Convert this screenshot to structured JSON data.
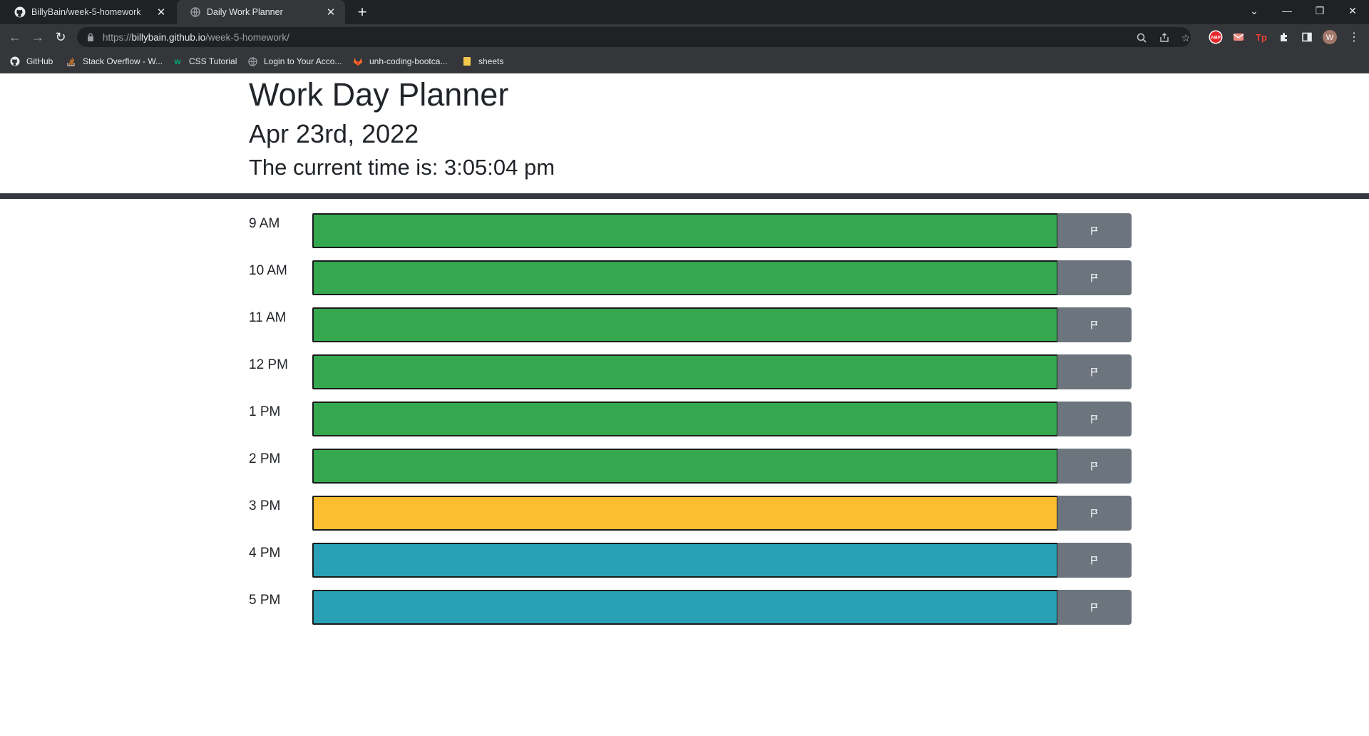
{
  "browser": {
    "tabs": [
      {
        "title": "BillyBain/week-5-homework",
        "icon": "github-icon",
        "active": false
      },
      {
        "title": "Daily Work Planner",
        "icon": "globe-icon",
        "active": true
      }
    ],
    "url": {
      "scheme": "https://",
      "host": "billybain.github.io",
      "path": "/week-5-homework/"
    },
    "bookmarks": [
      {
        "label": "GitHub",
        "icon": "github-icon"
      },
      {
        "label": "Stack Overflow - W...",
        "icon": "stackoverflow-icon"
      },
      {
        "label": "CSS Tutorial",
        "icon": "w3schools-icon"
      },
      {
        "label": "Login to Your Acco...",
        "icon": "globe-icon"
      },
      {
        "label": "unh-coding-bootca...",
        "icon": "gitlab-icon"
      },
      {
        "label": "sheets",
        "icon": "folder-icon"
      }
    ],
    "extensions": {
      "abp_label": "ABP",
      "tp_label": "Tp",
      "profile_initial": "W"
    }
  },
  "page": {
    "title": "Work Day Planner",
    "date": "Apr 23rd, 2022",
    "current_time": "The current time is: 3:05:04 pm"
  },
  "planner": {
    "rows": [
      {
        "hour": "9 AM",
        "status": "past",
        "color": "#34a84f",
        "text": ""
      },
      {
        "hour": "10 AM",
        "status": "past",
        "color": "#34a84f",
        "text": ""
      },
      {
        "hour": "11 AM",
        "status": "past",
        "color": "#34a84f",
        "text": ""
      },
      {
        "hour": "12 PM",
        "status": "past",
        "color": "#34a84f",
        "text": ""
      },
      {
        "hour": "1 PM",
        "status": "past",
        "color": "#34a84f",
        "text": ""
      },
      {
        "hour": "2 PM",
        "status": "past",
        "color": "#34a84f",
        "text": ""
      },
      {
        "hour": "3 PM",
        "status": "present",
        "color": "#fcbd2f",
        "text": ""
      },
      {
        "hour": "4 PM",
        "status": "future",
        "color": "#28a1b7",
        "text": ""
      },
      {
        "hour": "5 PM",
        "status": "future",
        "color": "#28a1b7",
        "text": ""
      }
    ],
    "save_icon": "flag-icon",
    "save_color": "#6c757d"
  }
}
